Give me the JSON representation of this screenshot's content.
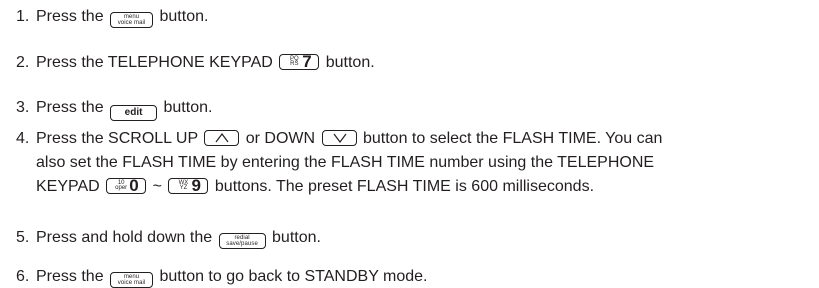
{
  "steps": [
    {
      "number": "1.",
      "before": "Press the",
      "key": {
        "top": "menu",
        "bottom": "voice mail"
      },
      "after": "button."
    },
    {
      "number": "2.",
      "before": "Press the TELEPHONE KEYPAD",
      "key": {
        "letters_top": "PQ",
        "letters_bottom": "RS",
        "digit": "7"
      },
      "after": "button."
    },
    {
      "number": "3.",
      "before": "Press the",
      "key": {
        "label": "edit"
      },
      "after": "button."
    },
    {
      "number": "4.",
      "text_a": "Press the SCROLL UP",
      "text_b": "or DOWN",
      "text_c": "button to select the FLASH TIME. You can",
      "line2": "also set the FLASH TIME by entering the FLASH TIME number using the TELEPHONE",
      "line3_a": "KEYPAD",
      "line3_sep": "~",
      "line3_b": "buttons. The preset FLASH TIME is 600 milliseconds.",
      "key_zero": {
        "letters_top": "10",
        "letters_bottom": "oper",
        "digit": "0"
      },
      "key_nine": {
        "letters_top": "WX",
        "letters_bottom": "YZ",
        "digit": "9"
      },
      "arrow_up_icon": "chevron-up-icon",
      "arrow_down_icon": "chevron-down-icon"
    },
    {
      "number": "5.",
      "before": "Press and hold down the",
      "key": {
        "top": "redial",
        "bottom": "save/pause"
      },
      "after": "button."
    },
    {
      "number": "6.",
      "before": "Press the",
      "key": {
        "top": "menu",
        "bottom": "voice mail"
      },
      "after": "button to go back to STANDBY mode."
    }
  ],
  "colors": {
    "text": "#231f20",
    "background": "#ffffff"
  }
}
